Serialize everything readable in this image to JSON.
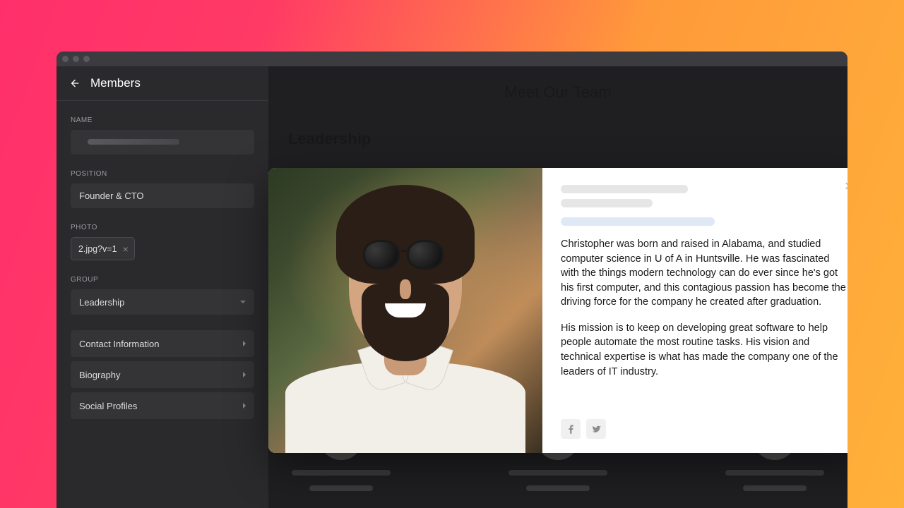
{
  "sidebar": {
    "title": "Members",
    "sections": {
      "name_label": "NAME",
      "position_label": "POSITION",
      "position_value": "Founder & CTO",
      "photo_label": "PHOTO",
      "photo_value": "2.jpg?v=1",
      "group_label": "GROUP",
      "group_value": "Leadership"
    },
    "accordions": {
      "contact": "Contact Information",
      "biography": "Biography",
      "social": "Social Profiles"
    }
  },
  "preview": {
    "page_title": "Meet Our Team",
    "section_title": "Leadership"
  },
  "modal": {
    "bio_p1": "Christopher was born and raised in Alabama, and studied computer science in U of A in Huntsville. He was fascinated with the things modern technology can do ever since he's got his first computer, and this contagious passion has become the driving force for the company he created after graduation.",
    "bio_p2": "His mission is to keep on developing great software to help people automate the most routine tasks. His vision and technical expertise is what has made the company one of the leaders of IT industry.",
    "social_icons": [
      "facebook-icon",
      "twitter-icon"
    ]
  }
}
